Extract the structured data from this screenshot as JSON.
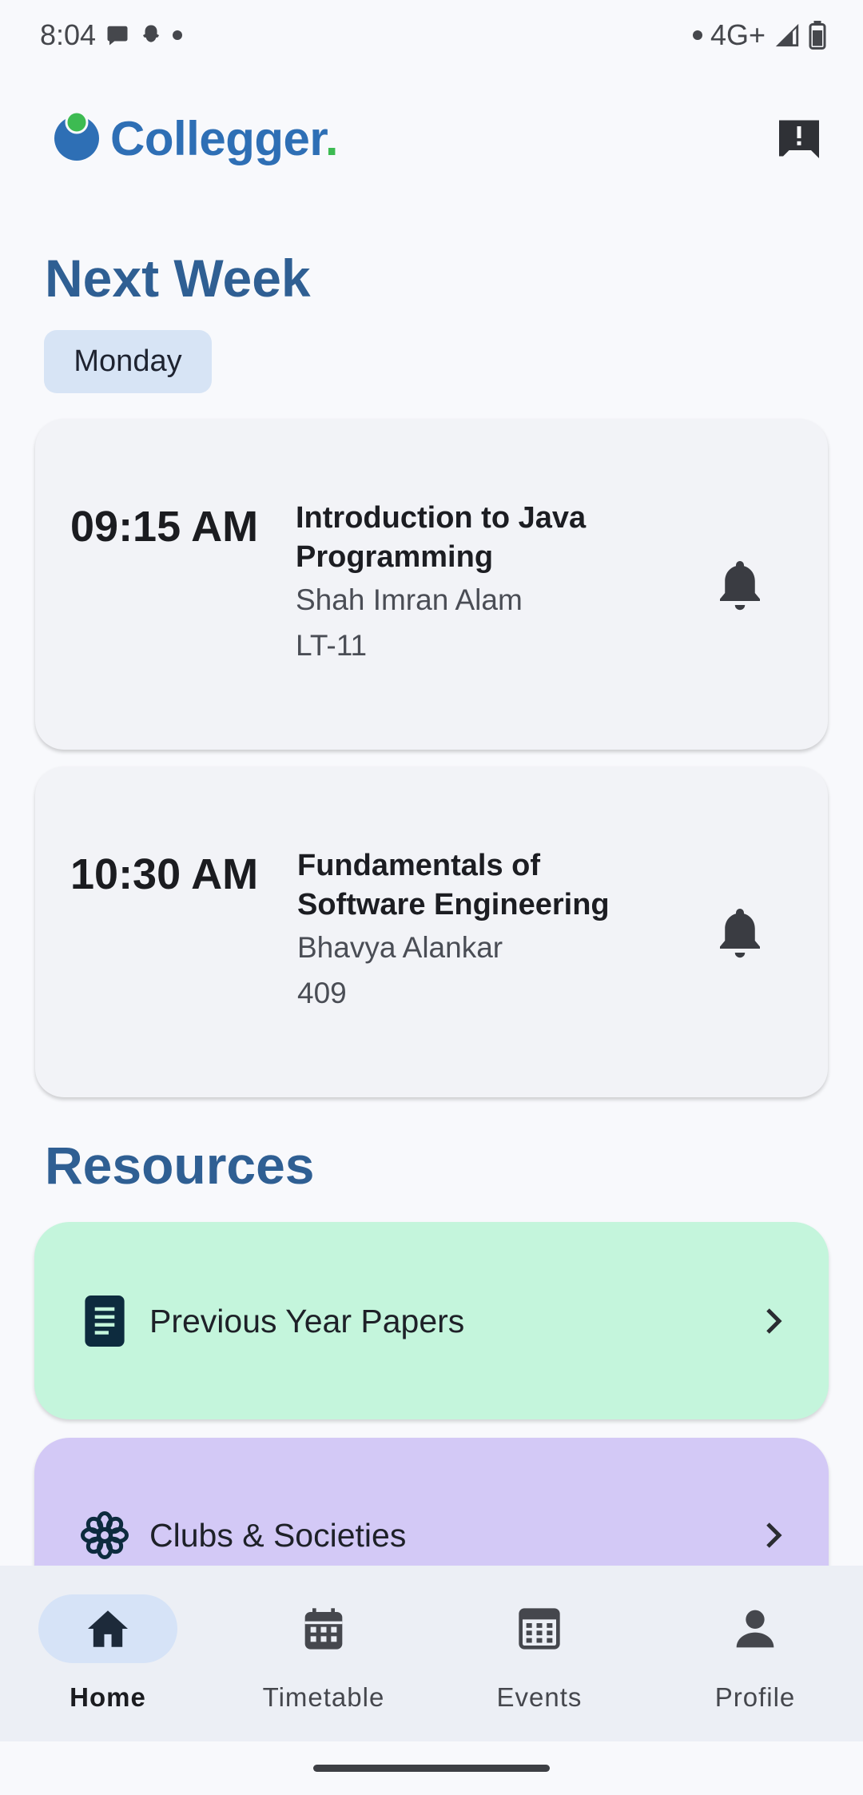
{
  "status_bar": {
    "time": "8:04",
    "network": "4G+",
    "icons": [
      "chat-bubble-icon",
      "snapchat-ghost-icon",
      "dot-icon",
      "signal-icon",
      "battery-icon"
    ]
  },
  "header": {
    "logo_text": "Collegger",
    "logo_dot": ".",
    "feedback_icon": "feedback-icon"
  },
  "schedule": {
    "title": "Next Week",
    "day": "Monday",
    "classes": [
      {
        "time": "09:15 AM",
        "title_line1": "Introduction to Java",
        "title_line2": "Programming",
        "teacher": "Shah Imran Alam",
        "room": "LT-11"
      },
      {
        "time": "10:30 AM",
        "title_line1": "Fundamentals of",
        "title_line2": "Software Engineering",
        "teacher": "Bhavya Alankar",
        "room": "409"
      }
    ]
  },
  "resources": {
    "title": "Resources",
    "items": [
      {
        "label": "Previous Year Papers",
        "icon": "document-icon",
        "color": "#c4f5dc"
      },
      {
        "label": "Clubs & Societies",
        "icon": "flower-icon",
        "color": "#d3c9f6"
      }
    ]
  },
  "bottom_nav": {
    "items": [
      {
        "label": "Home",
        "icon": "home-icon",
        "active": true
      },
      {
        "label": "Timetable",
        "icon": "calendar-icon",
        "active": false
      },
      {
        "label": "Events",
        "icon": "events-icon",
        "active": false
      },
      {
        "label": "Profile",
        "icon": "person-icon",
        "active": false
      }
    ]
  },
  "colors": {
    "brand_blue": "#2e6fb5",
    "brand_green": "#3dbb52",
    "section_title": "#2f5f93",
    "chip_bg": "#d7e4f5"
  }
}
